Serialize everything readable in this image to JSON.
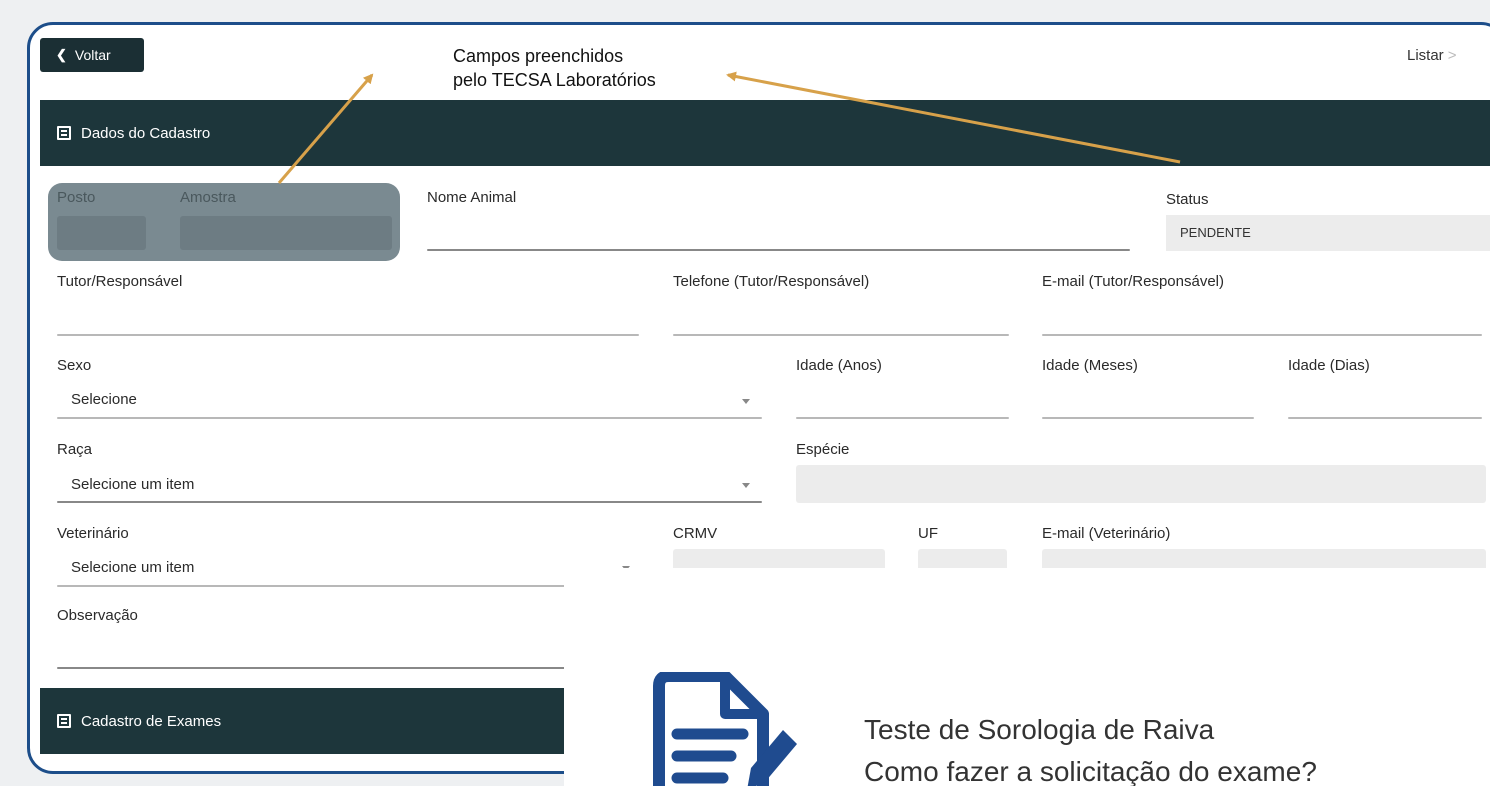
{
  "topbar": {
    "back_label": "Voltar",
    "list_label": "Listar",
    "annotation_line1": "Campos preenchidos",
    "annotation_line2": "pelo TECSA Laboratórios"
  },
  "sections": {
    "cadastro_title": "Dados do Cadastro",
    "exames_title": "Cadastro de Exames"
  },
  "form": {
    "posto_label": "Posto",
    "amostra_label": "Amostra",
    "nome_animal_label": "Nome Animal",
    "status_label": "Status",
    "status_value": "PENDENTE",
    "tutor_label": "Tutor/Responsável",
    "telefone_label": "Telefone (Tutor/Responsável)",
    "email_tutor_label": "E-mail (Tutor/Responsável)",
    "sexo_label": "Sexo",
    "sexo_value": "Selecione",
    "idade_anos_label": "Idade (Anos)",
    "idade_meses_label": "Idade (Meses)",
    "idade_dias_label": "Idade (Dias)",
    "raca_label": "Raça",
    "raca_value": "Selecione um item",
    "especie_label": "Espécie",
    "veterinario_label": "Veterinário",
    "veterinario_value": "Selecione um item",
    "crmv_label": "CRMV",
    "uf_label": "UF",
    "email_vet_label": "E-mail (Veterinário)",
    "observacao_label": "Observação"
  },
  "overlay": {
    "line1": "Teste de Sorologia de Raiva",
    "line2": "Como fazer a solicitação do exame?"
  },
  "colors": {
    "section_bg": "#1d363b",
    "frame_border": "#1d4e8a",
    "arrow": "#d7a14a",
    "icon_blue": "#1f4b8f"
  }
}
